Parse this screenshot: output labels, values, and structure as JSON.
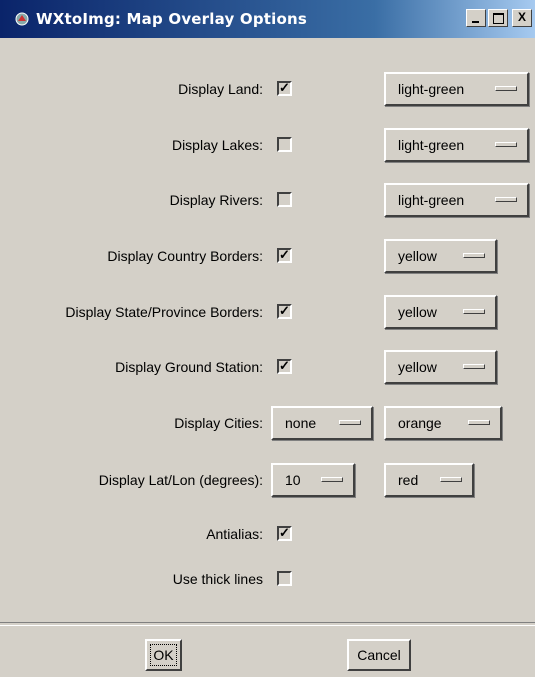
{
  "window": {
    "title": "WXtoImg: Map Overlay Options",
    "controls": {
      "minimize": "",
      "maximize": "",
      "close": "X"
    }
  },
  "rows": [
    {
      "label": "Display Land:",
      "checked": true,
      "check_glyph": "✓",
      "menu": "light-green"
    },
    {
      "label": "Display Lakes:",
      "checked": false,
      "check_glyph": "",
      "menu": "light-green"
    },
    {
      "label": "Display Rivers:",
      "checked": false,
      "check_glyph": "",
      "menu": "light-green"
    },
    {
      "label": "Display Country Borders:",
      "checked": true,
      "check_glyph": "✓",
      "menu": "yellow"
    },
    {
      "label": "Display State/Province Borders:",
      "checked": true,
      "check_glyph": "✓",
      "menu": "yellow"
    },
    {
      "label": "Display Ground Station:",
      "checked": true,
      "check_glyph": "✓",
      "menu": "yellow"
    },
    {
      "label": "Display Cities:",
      "menu1": "none",
      "menu2": "orange"
    },
    {
      "label": "Display Lat/Lon (degrees):",
      "menu1": "10",
      "menu2": "red"
    },
    {
      "label": "Antialias:",
      "checked": true,
      "check_glyph": "✓"
    },
    {
      "label": "Use thick lines",
      "checked": false,
      "check_glyph": ""
    }
  ],
  "buttons": {
    "ok": "OK",
    "cancel": "Cancel"
  }
}
